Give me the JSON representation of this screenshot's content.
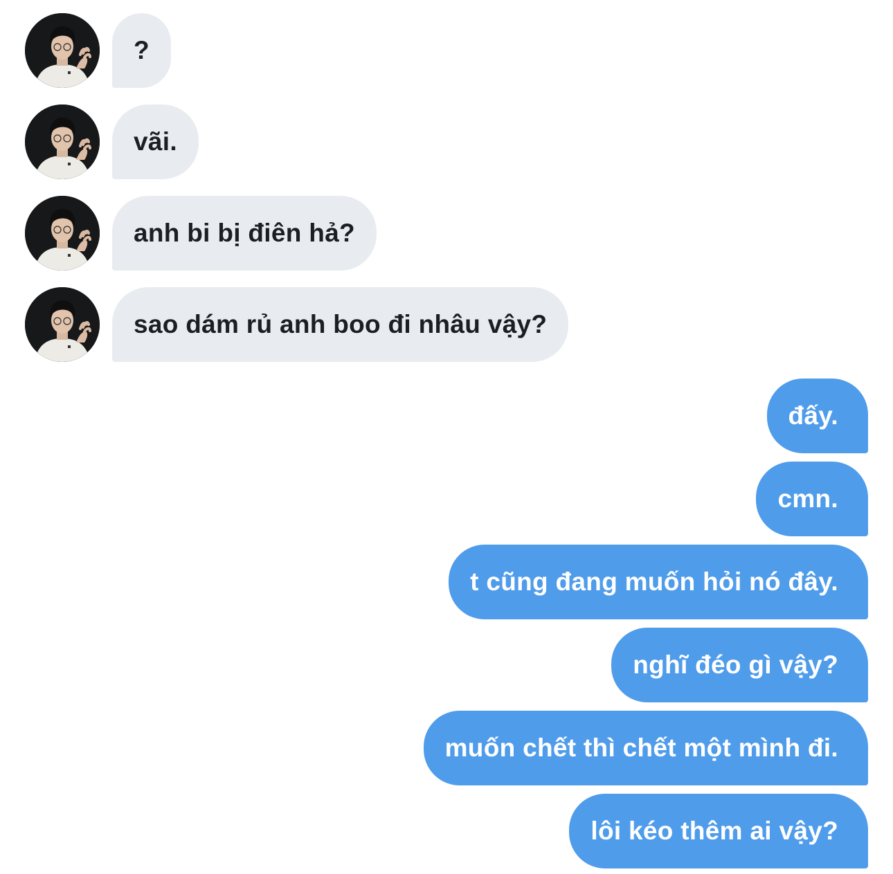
{
  "incoming": [
    {
      "text": "?"
    },
    {
      "text": "vãi."
    },
    {
      "text": "anh bi bị điên hả?"
    },
    {
      "text": "sao dám rủ anh boo đi nhâu vậy?"
    }
  ],
  "outgoing": [
    {
      "text": "đấy."
    },
    {
      "text": "cmn."
    },
    {
      "text": "t cũng đang muốn hỏi nó đây."
    },
    {
      "text": "nghĩ đéo gì vậy?"
    },
    {
      "text": "muốn chết thì chết một mình đi."
    },
    {
      "text": "lôi kéo thêm ai vậy?"
    }
  ],
  "colors": {
    "incoming_bubble": "#e8ecf0",
    "incoming_text": "#1c1f22",
    "outgoing_bubble": "#4f9ceb",
    "outgoing_text": "#ffffff",
    "background": "#ffffff"
  }
}
